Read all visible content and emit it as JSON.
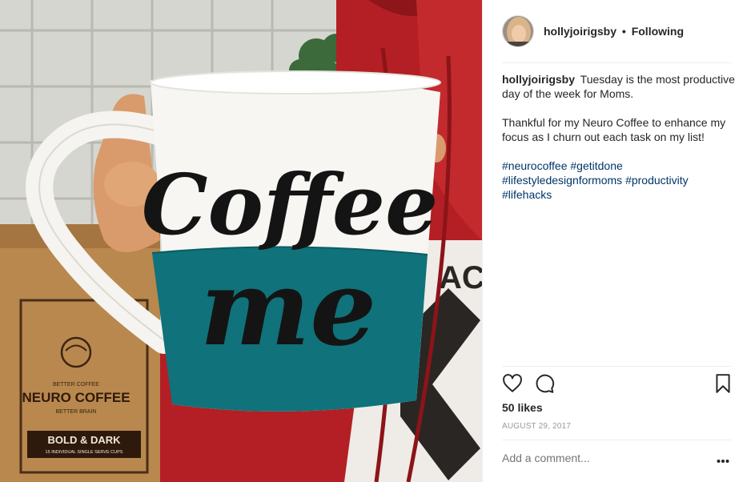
{
  "post": {
    "username": "hollyjoirigsby",
    "follow_separator": "•",
    "follow_label": "Following"
  },
  "caption": {
    "username": "hollyjoirigsby",
    "line1": "Tuesday is the most productive day of the week for Moms.",
    "line2": "Thankful for my Neuro Coffee to enhance my focus as I churn out each task on my list!",
    "hashtags": [
      "#neurocoffee",
      "#getitdone",
      "#lifestyledesignformoms",
      "#productivity",
      "#lifehacks"
    ]
  },
  "photo": {
    "mug_text_top": "Coffee",
    "mug_text_bottom": "me",
    "bag_tagline_top": "BETTER COFFEE",
    "bag_brand": "NEURO COFFEE",
    "bag_tagline_bottom": "BETTER BRAIN",
    "bag_variant": "BOLD & DARK",
    "bag_subtitle": "15 INDIVIDUAL SINGLE SERVE CUPS",
    "shirt_letters": "AC"
  },
  "stats": {
    "likes": "50 likes",
    "date": "AUGUST 29, 2017"
  },
  "comment": {
    "placeholder": "Add a comment..."
  },
  "icons": {
    "like": "heart-icon",
    "comment": "comment-bubble-icon",
    "save": "bookmark-icon",
    "more": "more-options-icon"
  },
  "colors": {
    "hashtag": "#003569",
    "muted": "#999999",
    "mug_teal": "#10727a"
  }
}
